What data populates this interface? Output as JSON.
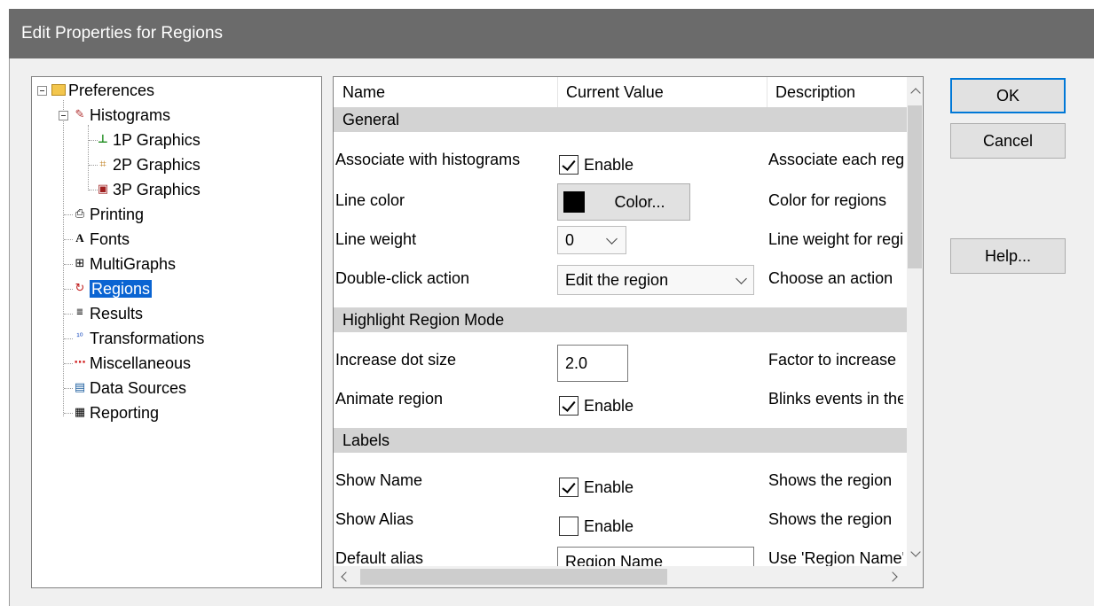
{
  "window": {
    "title": "Edit Properties for Regions"
  },
  "tree": {
    "items": [
      {
        "label": "Preferences",
        "icon": "folder-icon"
      },
      {
        "label": "Histograms",
        "icon": "histogram-icon"
      },
      {
        "label": "1P Graphics",
        "icon": "1p-graphics-icon"
      },
      {
        "label": "2P Graphics",
        "icon": "2p-graphics-icon"
      },
      {
        "label": "3P Graphics",
        "icon": "3p-graphics-icon"
      },
      {
        "label": "Printing",
        "icon": "printer-icon"
      },
      {
        "label": "Fonts",
        "icon": "font-icon"
      },
      {
        "label": "MultiGraphs",
        "icon": "multigraph-icon"
      },
      {
        "label": "Regions",
        "icon": "regions-icon",
        "selected": true
      },
      {
        "label": "Results",
        "icon": "results-icon"
      },
      {
        "label": "Transformations",
        "icon": "transform-icon"
      },
      {
        "label": "Miscellaneous",
        "icon": "misc-icon"
      },
      {
        "label": "Data Sources",
        "icon": "data-sources-icon"
      },
      {
        "label": "Reporting",
        "icon": "reporting-icon"
      }
    ]
  },
  "grid": {
    "columns": [
      "Name",
      "Current Value",
      "Description"
    ],
    "sections": {
      "general": "General",
      "highlight": "Highlight Region Mode",
      "labels": "Labels"
    },
    "rows": {
      "associate": {
        "name": "Associate with histograms",
        "value": "Enable",
        "checked": true,
        "desc": "Associate each region"
      },
      "line_color": {
        "name": "Line color",
        "button": "Color...",
        "swatch": "#000000",
        "desc": "Color for regions"
      },
      "line_weight": {
        "name": "Line weight",
        "value": "0",
        "desc": "Line weight for regions"
      },
      "double_click": {
        "name": "Double-click action",
        "value": "Edit the region",
        "desc": "Choose an action"
      },
      "dot_size": {
        "name": "Increase dot size",
        "value": "2.0",
        "desc": "Factor to increase"
      },
      "animate": {
        "name": "Animate region",
        "value": "Enable",
        "checked": true,
        "desc": "Blinks events in the"
      },
      "show_name": {
        "name": "Show Name",
        "value": "Enable",
        "checked": true,
        "desc": "Shows the region"
      },
      "show_alias": {
        "name": "Show Alias",
        "value": "Enable",
        "checked": false,
        "desc": "Shows the region"
      },
      "default_alias": {
        "name": "Default alias",
        "value": "Region Name",
        "desc": "Use 'Region Name'"
      }
    }
  },
  "buttons": {
    "ok": "OK",
    "cancel": "Cancel",
    "help": "Help..."
  }
}
